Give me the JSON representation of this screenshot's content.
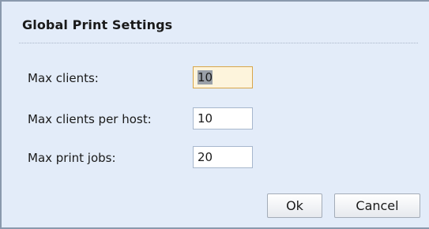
{
  "dialog": {
    "title": "Global Print Settings"
  },
  "fields": [
    {
      "label": "Max clients:",
      "value": "10"
    },
    {
      "label": "Max clients per host:",
      "value": "10"
    },
    {
      "label": "Max print jobs:",
      "value": "20"
    }
  ],
  "buttons": {
    "ok_label": "Ok",
    "cancel_label": "Cancel"
  },
  "colors": {
    "background": "#e3ecf9",
    "focus_border": "#d8a64a",
    "focus_fill": "#fdf4dc"
  }
}
